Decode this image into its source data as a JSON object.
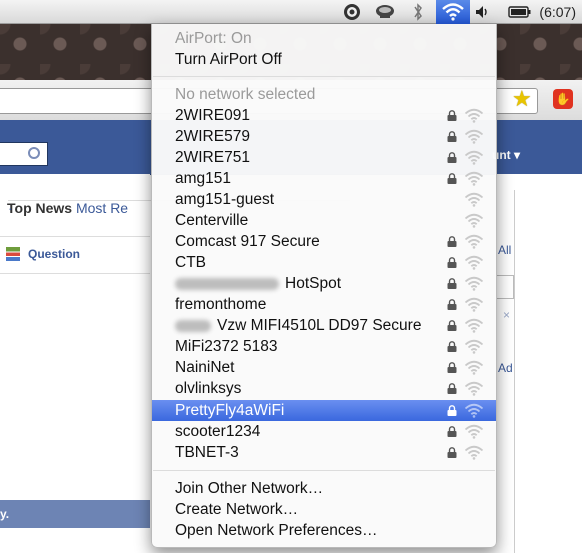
{
  "menubar": {
    "clock": "(6:07)",
    "icons": [
      "gear-icon",
      "cup-icon",
      "bluetooth-icon",
      "wifi-icon",
      "volume-icon",
      "battery-icon"
    ]
  },
  "background": {
    "top_news": "Top News",
    "dot": "·",
    "most_recent": "Most Re",
    "question": "Question",
    "account": "unt ▾",
    "all": "All",
    "ad": "Ad",
    "close_x": "×",
    "footer_fragment": "y."
  },
  "airport_menu": {
    "status": "AirPort: On",
    "toggle": "Turn AirPort Off",
    "no_network": "No network selected",
    "networks": [
      {
        "name": "2WIRE091",
        "locked": true
      },
      {
        "name": "2WIRE579",
        "locked": true
      },
      {
        "name": "2WIRE751",
        "locked": true
      },
      {
        "name": "amg151",
        "locked": true
      },
      {
        "name": "amg151-guest",
        "locked": false
      },
      {
        "name": "Centerville",
        "locked": false
      },
      {
        "name": "Comcast 917 Secure",
        "locked": true
      },
      {
        "name": "CTB",
        "locked": true
      },
      {
        "name": "HotSpot",
        "locked": true
      },
      {
        "name": "fremonthome",
        "locked": true
      },
      {
        "name": "Vzw MIFI4510L DD97 Secure",
        "locked": true
      },
      {
        "name": "MiFi2372 5183",
        "locked": true
      },
      {
        "name": "NainiNet",
        "locked": true
      },
      {
        "name": "olvlinksys",
        "locked": true
      },
      {
        "name": "PrettyFly4aWiFi",
        "locked": true,
        "selected": true
      },
      {
        "name": "scooter1234",
        "locked": true
      },
      {
        "name": "TBNET-3",
        "locked": true
      }
    ],
    "join_other": "Join Other Network…",
    "create": "Create Network…",
    "open_prefs": "Open Network Preferences…"
  },
  "colors": {
    "selection": "#3a68de",
    "facebook_blue": "#3b5998"
  }
}
